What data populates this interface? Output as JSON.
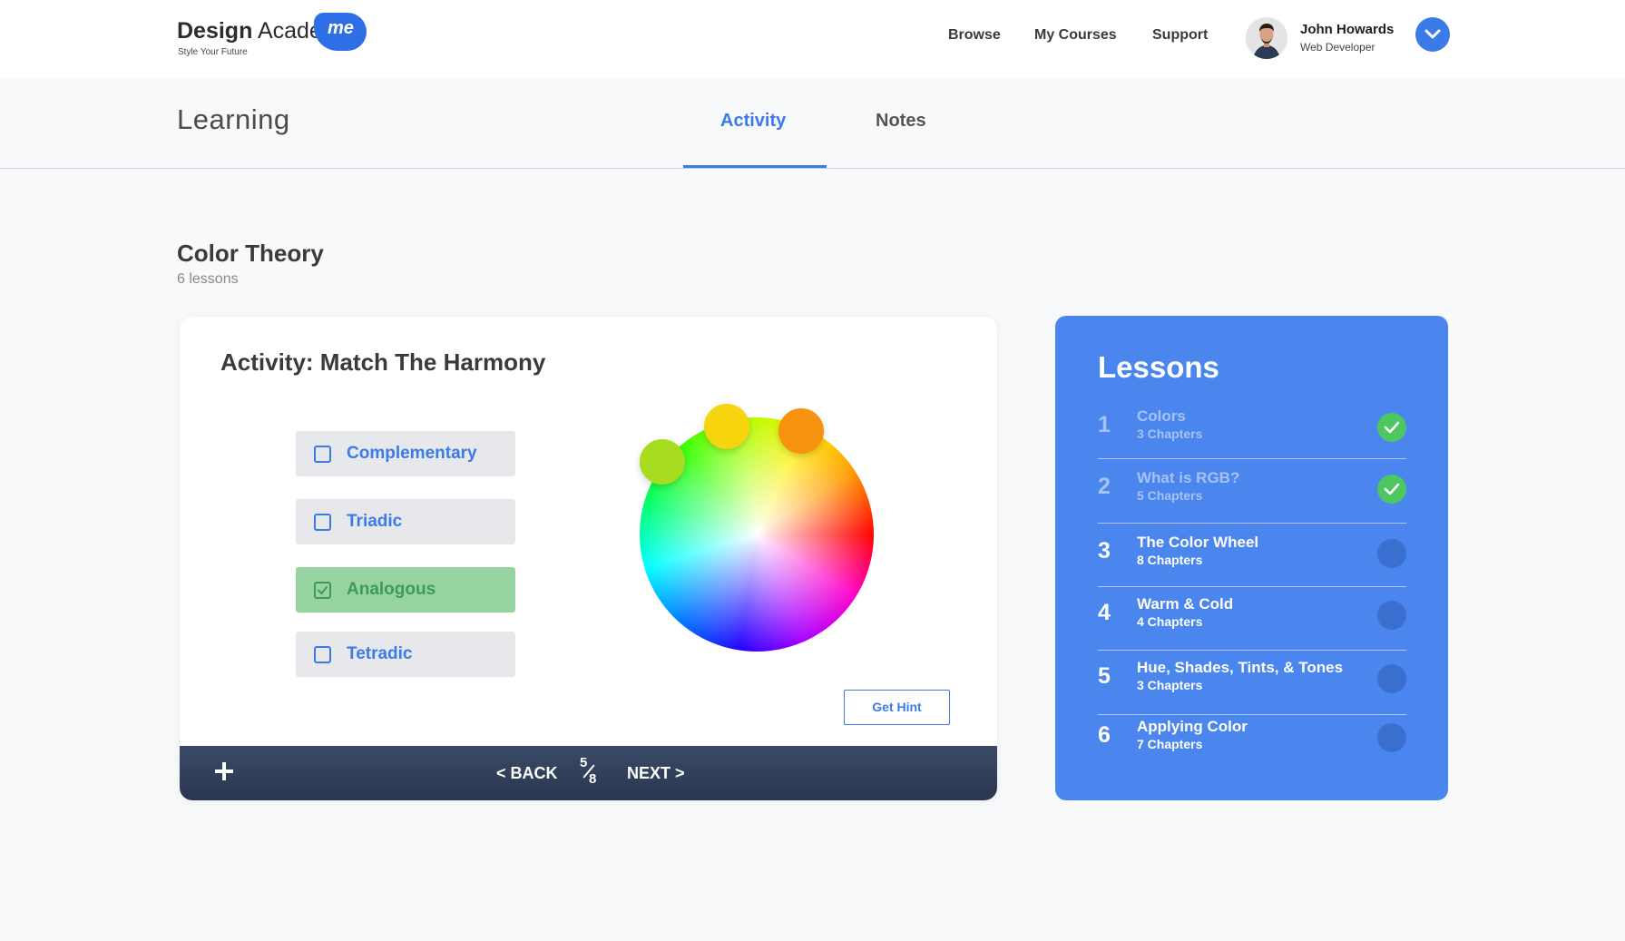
{
  "brand": {
    "name_bold": "Design",
    "name_light": "Acade",
    "badge": "me",
    "tagline": "Style Your Future",
    "color": "#2f6fe5"
  },
  "nav": {
    "browse": "Browse",
    "my_courses": "My Courses",
    "support": "Support"
  },
  "user": {
    "name": "John Howards",
    "role": "Web Developer",
    "menu_icon": "chevron-down-icon"
  },
  "subheader": {
    "title": "Learning",
    "tabs": [
      {
        "label": "Activity",
        "active": true
      },
      {
        "label": "Notes",
        "active": false
      }
    ]
  },
  "course": {
    "title": "Color Theory",
    "lesson_count": "6 lessons"
  },
  "activity": {
    "title": "Activity: Match The Harmony",
    "options": [
      {
        "label": "Complementary",
        "checked": false
      },
      {
        "label": "Triadic",
        "checked": false
      },
      {
        "label": "Analogous",
        "checked": true
      },
      {
        "label": "Tetradic",
        "checked": false
      }
    ],
    "wheel_handles": [
      "#a8dc1e",
      "#f7d50e",
      "#f7920e"
    ],
    "hint_button": "Get Hint",
    "footer": {
      "back": "< BACK",
      "next": "NEXT >",
      "current": "5",
      "total": "8"
    }
  },
  "lessons": {
    "title": "Lessons",
    "items": [
      {
        "num": "1",
        "name": "Colors",
        "chapters": "3 Chapters",
        "completed": true
      },
      {
        "num": "2",
        "name": "What is RGB?",
        "chapters": "5 Chapters",
        "completed": true
      },
      {
        "num": "3",
        "name": "The Color Wheel",
        "chapters": "8 Chapters",
        "completed": false
      },
      {
        "num": "4",
        "name": "Warm & Cold",
        "chapters": "4 Chapters",
        "completed": false
      },
      {
        "num": "5",
        "name": "Hue, Shades, Tints, & Tones",
        "chapters": "3 Chapters",
        "completed": false
      },
      {
        "num": "6",
        "name": "Applying Color",
        "chapters": "7 Chapters",
        "completed": false
      }
    ],
    "colors": {
      "panel": "#4a86ee",
      "done": "#4dc860",
      "todo": "#3a6fcf"
    }
  }
}
